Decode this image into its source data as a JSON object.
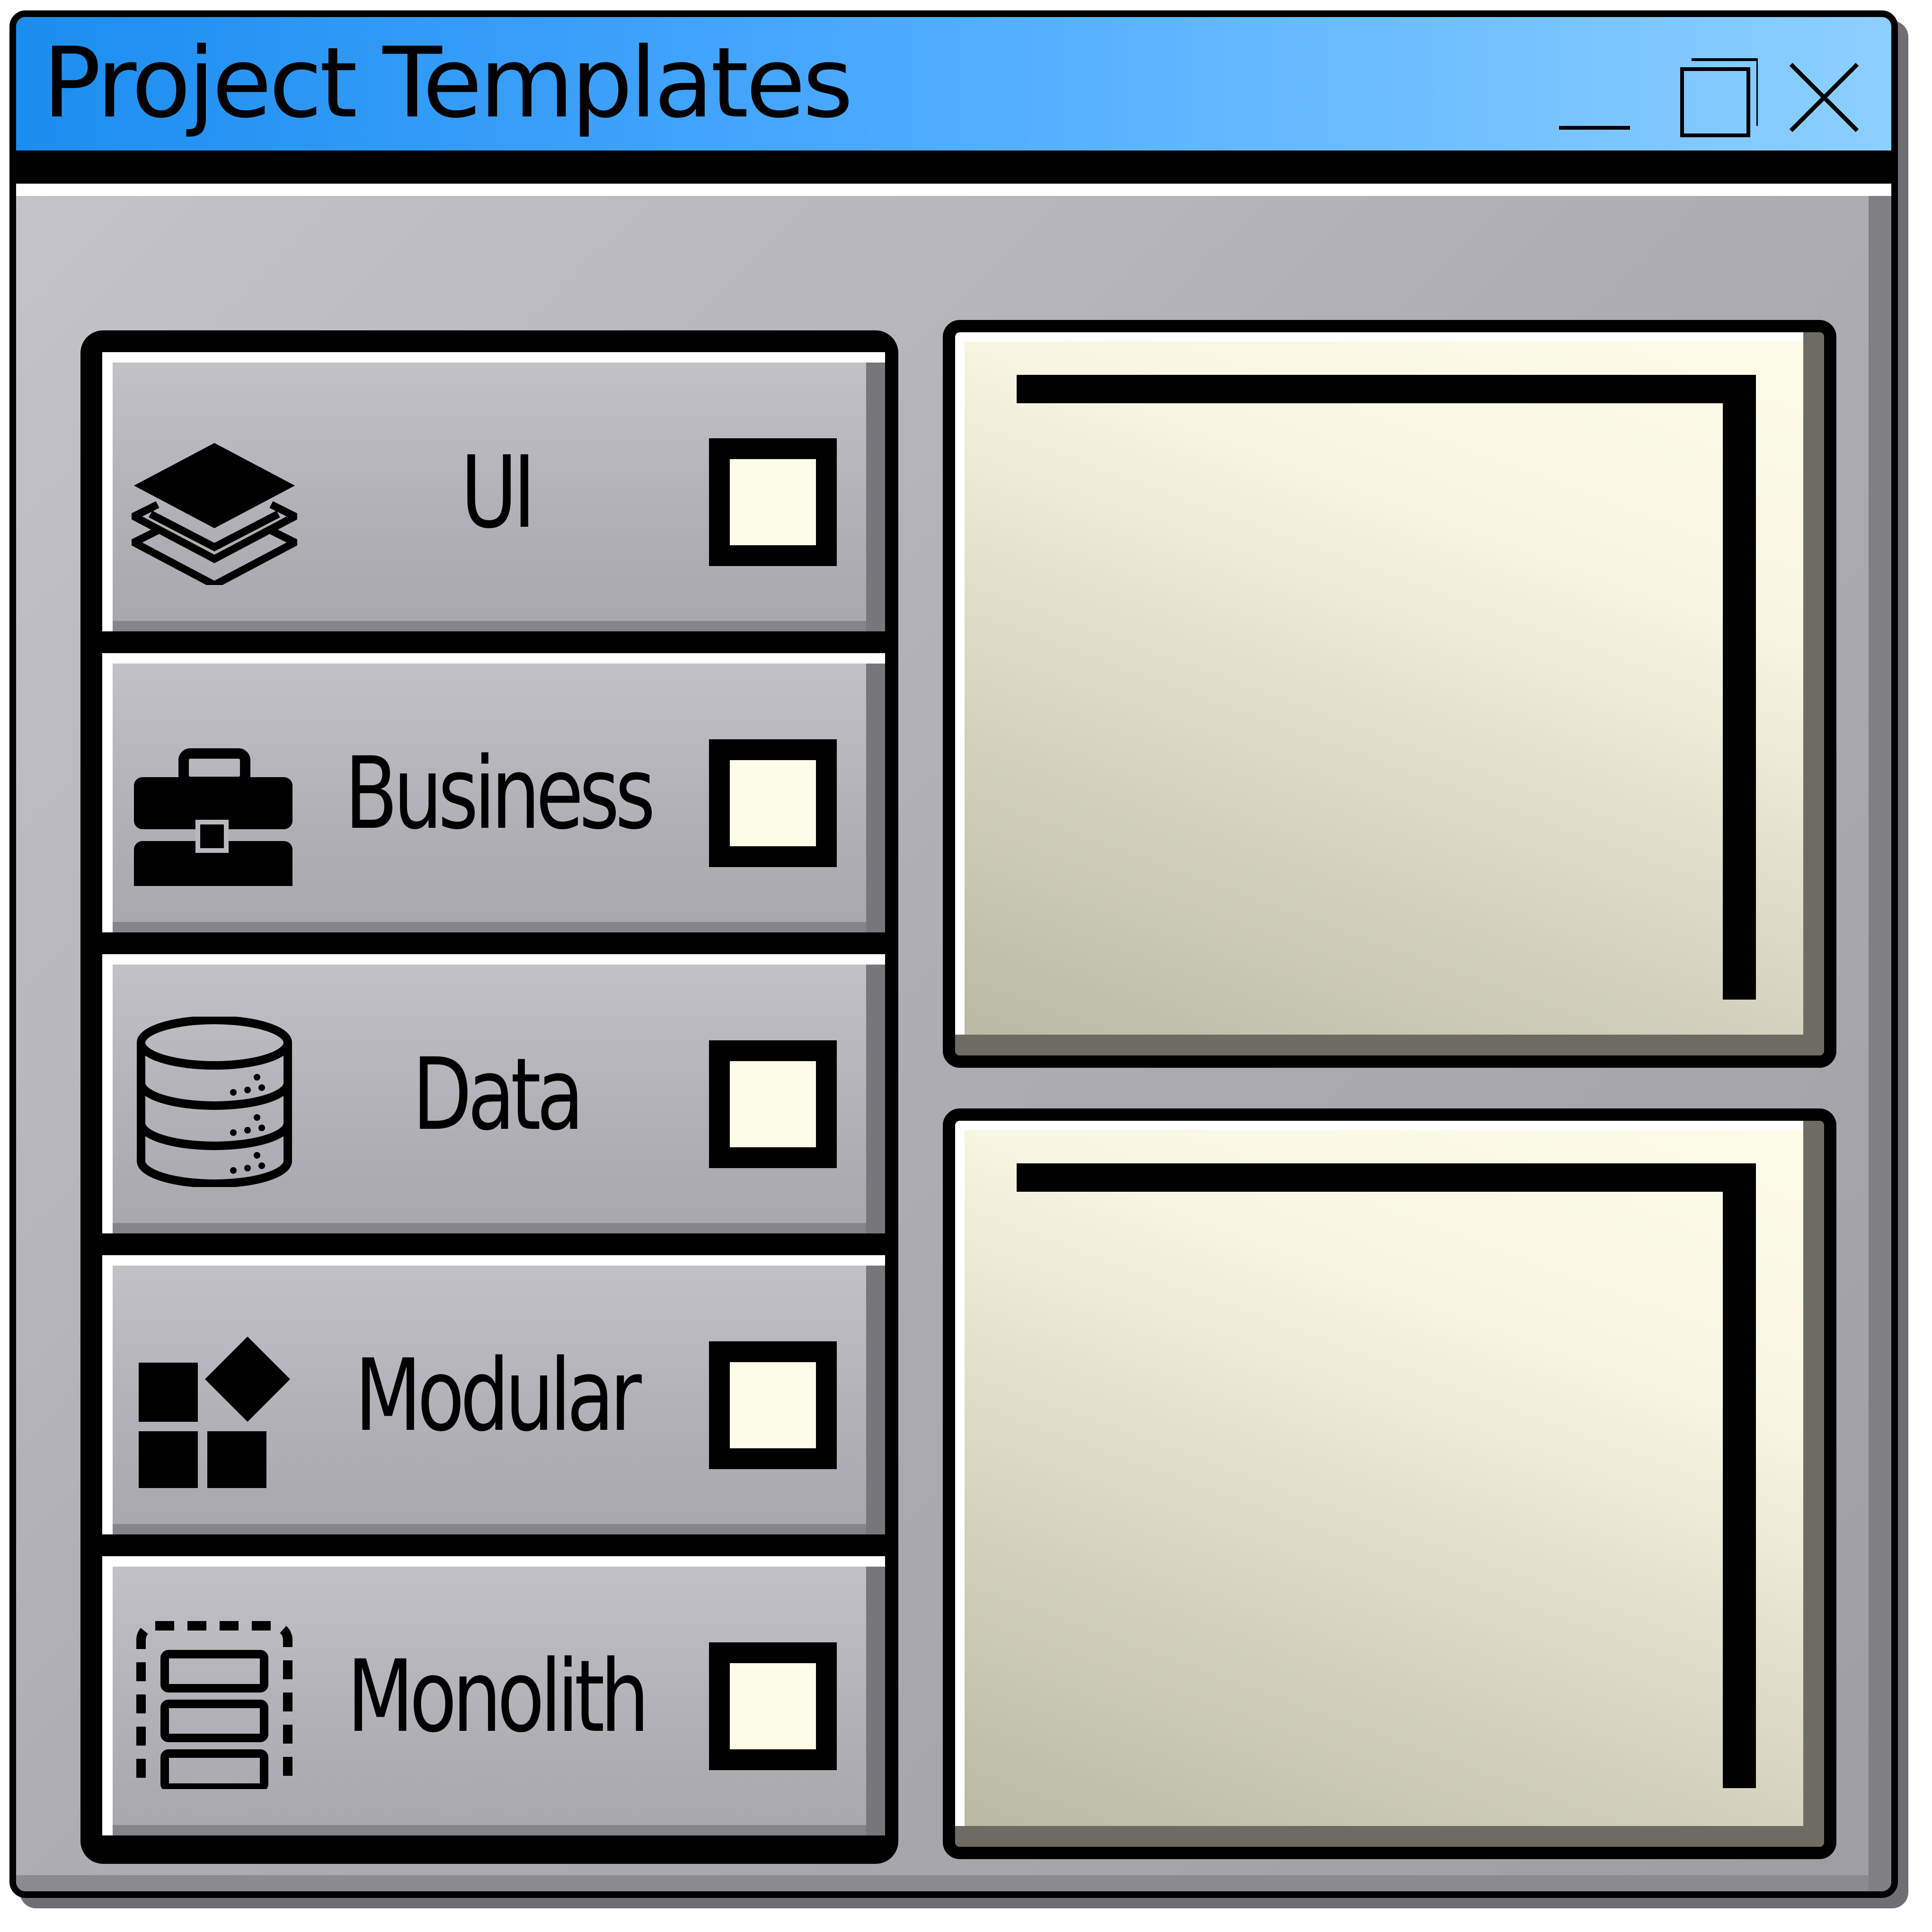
{
  "window": {
    "title": "Project Templates",
    "controls": [
      "minimize",
      "maximize",
      "close"
    ]
  },
  "templates": [
    {
      "label": "UI",
      "icon": "layers-icon",
      "checked": false
    },
    {
      "label": "Business",
      "icon": "briefcase-icon",
      "checked": false
    },
    {
      "label": "Data",
      "icon": "database-icon",
      "checked": false
    },
    {
      "label": "Modular",
      "icon": "modules-icon",
      "checked": false
    },
    {
      "label": "Monolith",
      "icon": "monolith-icon",
      "checked": false
    }
  ],
  "colors": {
    "titlebar_start": "#1b8df0",
    "titlebar_end": "#8dd0ff",
    "panel": "#a7a7ad",
    "preview_fill": "#fdfce6",
    "checkbox_fill": "#fdfce6"
  }
}
